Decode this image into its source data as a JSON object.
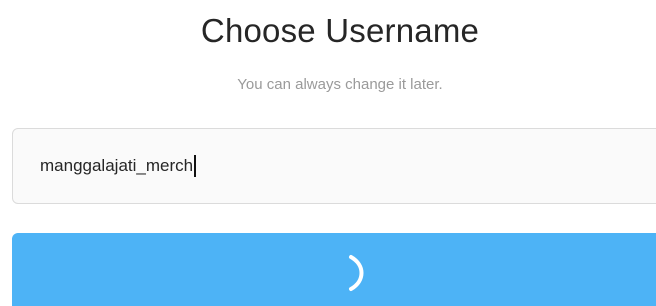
{
  "header": {
    "title": "Choose Username",
    "subtitle": "You can always change it later."
  },
  "username_field": {
    "value": "manggalajati_merch"
  },
  "next_button": {
    "state": "loading",
    "icon": "spinner-icon",
    "color": "#4db3f6"
  }
}
